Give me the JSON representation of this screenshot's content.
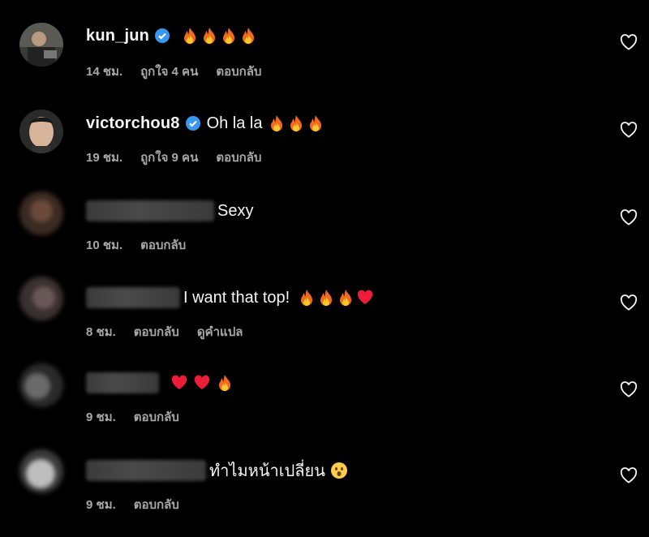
{
  "comments": [
    {
      "username": "kun_jun",
      "verified": true,
      "text": "",
      "emojis": [
        "fire",
        "fire",
        "fire",
        "fire"
      ],
      "time": "14 ชม.",
      "likes": "ถูกใจ 4 คน",
      "reply": "ตอบกลับ",
      "translate": ""
    },
    {
      "username": "victorchou8",
      "verified": true,
      "text": "Oh la la",
      "emojis": [
        "fire",
        "fire",
        "fire"
      ],
      "time": "19 ชม.",
      "likes": "ถูกใจ 9 คน",
      "reply": "ตอบกลับ",
      "translate": ""
    },
    {
      "username": "",
      "verified": false,
      "text": "Sexy",
      "emojis": [],
      "time": "10 ชม.",
      "likes": "",
      "reply": "ตอบกลับ",
      "translate": ""
    },
    {
      "username": "",
      "verified": false,
      "text": "I want that top!",
      "emojis": [
        "fire",
        "fire",
        "fire",
        "heart"
      ],
      "time": "8 ชม.",
      "likes": "",
      "reply": "ตอบกลับ",
      "translate": "ดูคำแปล"
    },
    {
      "username": "",
      "verified": false,
      "text": "",
      "emojis": [
        "heart",
        "heart",
        "fire"
      ],
      "time": "9 ชม.",
      "likes": "",
      "reply": "ตอบกลับ",
      "translate": ""
    },
    {
      "username": "",
      "verified": false,
      "text": "ทำไมหน้าเปลี่ยน",
      "emojis": [
        "surprised"
      ],
      "time": "9 ชม.",
      "likes": "",
      "reply": "ตอบกลับ",
      "translate": ""
    }
  ],
  "icons": {
    "like": "heart-outline-icon",
    "verified": "verified-badge-icon"
  },
  "colors": {
    "background": "#000000",
    "meta_text": "#a8a8a8",
    "verified_blue": "#3897f0",
    "heart_red": "#ed1d3a"
  }
}
